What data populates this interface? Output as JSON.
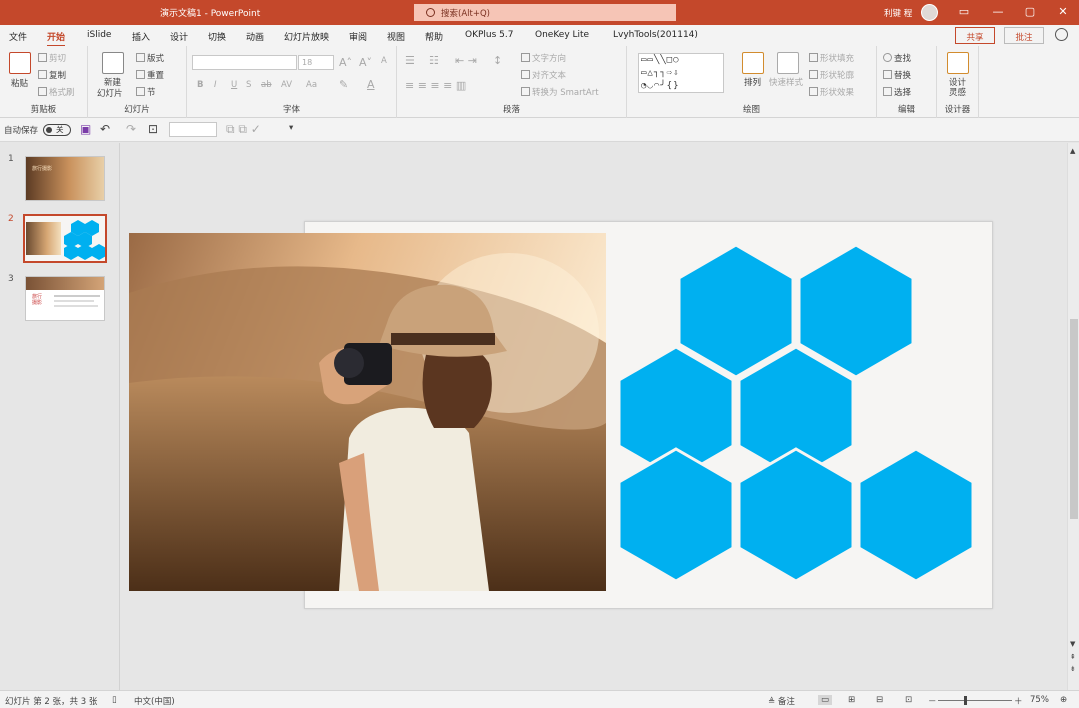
{
  "window": {
    "doc_title": "演示文稿1 - PowerPoint",
    "search_placeholder": "搜索(Alt+Q)",
    "user": "利键 程",
    "minimize": "—",
    "restore": "❐",
    "maximize": "▢",
    "close": "✕"
  },
  "tabs": [
    "文件",
    "开始",
    "iSlide",
    "插入",
    "设计",
    "切换",
    "动画",
    "幻灯片放映",
    "审阅",
    "视图",
    "帮助",
    "OKPlus 5.7",
    "OneKey Lite",
    "LvyhTools(201114)"
  ],
  "active_tab": 1,
  "share": "共享",
  "comment": "批注",
  "ribbon": {
    "clipboard": {
      "paste": "粘贴",
      "cut": "剪切",
      "copy": "复制",
      "format_painter": "格式刷",
      "label": "剪贴板"
    },
    "slides": {
      "new_slide": "新建",
      "new_slide2": "幻灯片",
      "layout": "版式",
      "reset": "重置",
      "section": "节",
      "label": "幻灯片"
    },
    "font": {
      "size": "18",
      "bold": "B",
      "italic": "I",
      "underline": "U",
      "strike": "S",
      "shadow": "ab",
      "spacing": "AV",
      "case": "Aa",
      "label": "字体"
    },
    "paragraph": {
      "text_direction": "文字方向",
      "align_text": "对齐文本",
      "smartart": "转换为 SmartArt",
      "label": "段落"
    },
    "drawing": {
      "arrange": "排列",
      "quick_styles": "快速样式",
      "fill": "形状填充",
      "outline": "形状轮廓",
      "effects": "形状效果",
      "label": "绘图"
    },
    "editing": {
      "find": "查找",
      "replace": "替换",
      "select": "选择",
      "label": "编辑"
    },
    "designer": {
      "design_ideas": "设计",
      "design_ideas2": "灵感",
      "label": "设计器"
    }
  },
  "qat": {
    "autosave": "自动保存",
    "toggle": "关"
  },
  "thumbnails": [
    {
      "num": "1",
      "title": "旅行摄影"
    },
    {
      "num": "2"
    },
    {
      "num": "3",
      "title": "旅行摄影"
    }
  ],
  "selected_slide": 2,
  "status": {
    "slide_info": "幻灯片 第 2 张，共 3 张",
    "language": "中文(中国)",
    "notes": "备注",
    "zoom": "75%",
    "zoom_out": "－",
    "zoom_in": "＋"
  },
  "colors": {
    "accent": "#c4482b",
    "hex": "#00b0f0",
    "slide_bg": "#f6f5f3"
  }
}
